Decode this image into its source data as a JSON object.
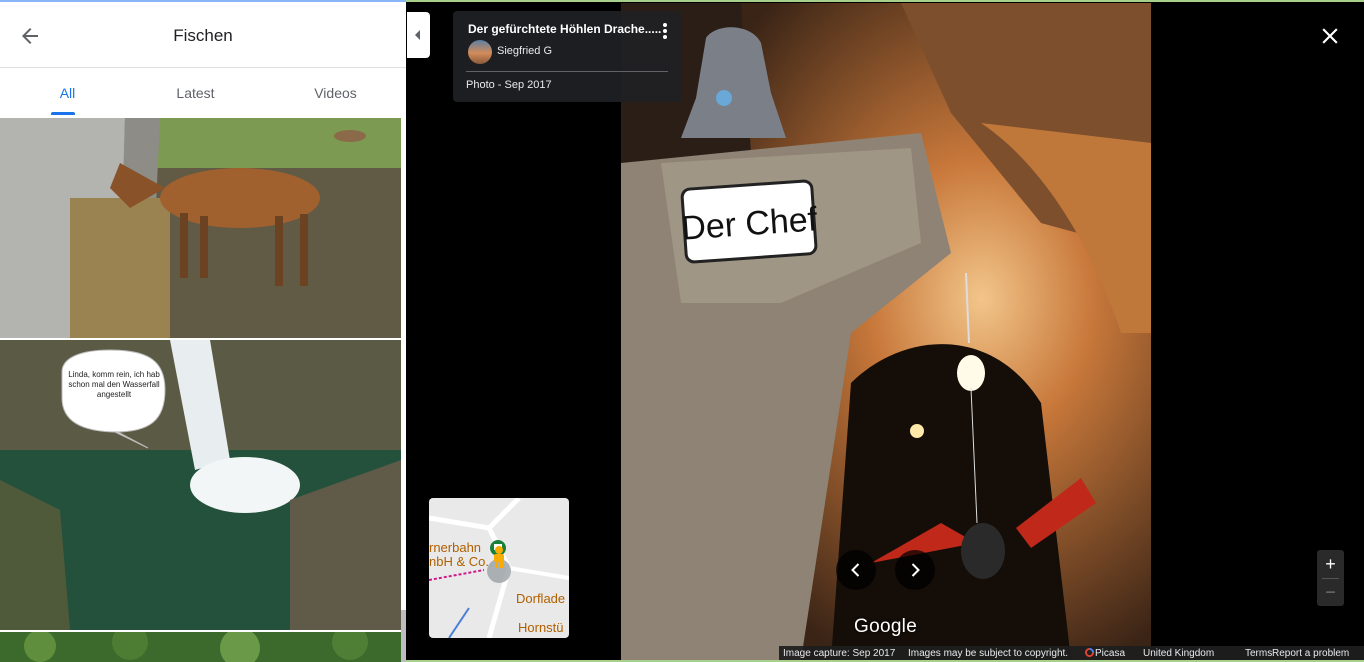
{
  "header": {
    "title": "Fischen",
    "back_icon": "arrow-back-icon"
  },
  "tabs": [
    {
      "label": "All",
      "active": true
    },
    {
      "label": "Latest",
      "active": false
    },
    {
      "label": "Videos",
      "active": false
    }
  ],
  "photos": {
    "speech_bubble": "Linda, komm rein, ich hab schon mal den Wasserfall angestellt"
  },
  "info_card": {
    "title": "Der gefürchtete Höhlen Drache.....",
    "author": "Siegfried G",
    "date": "Photo - Sep 2017"
  },
  "photo_content": {
    "sign_text": "Der Chef"
  },
  "minimap": {
    "label_1": "rnerbahn",
    "label_2": "nbH & Co.",
    "label_3": "Dorflade",
    "label_4": "Hornstü"
  },
  "watermark": "Google",
  "zoom": {
    "in": "+",
    "out": "−"
  },
  "footer": {
    "capture": "Image capture: Sep 2017",
    "copyright": "Images may be subject to copyright.",
    "picasa": "Picasa",
    "region": "United Kingdom",
    "terms": "Terms",
    "report": "Report a problem"
  },
  "colors": {
    "accent": "#1a73e8",
    "card_bg": "#202124",
    "footer_bg": "#1e1e1e"
  }
}
